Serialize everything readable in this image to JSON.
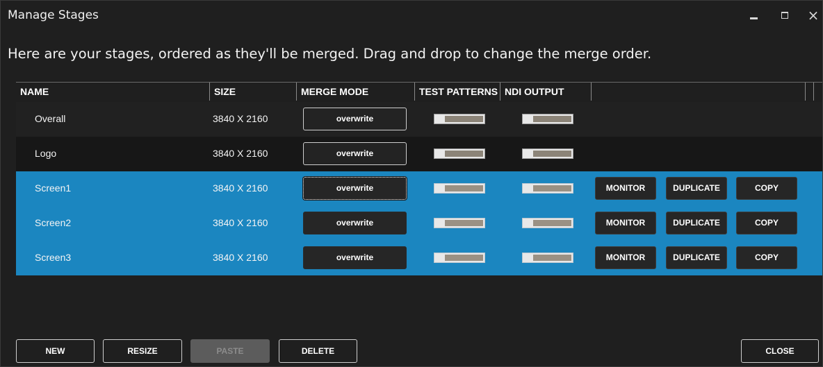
{
  "window": {
    "title": "Manage Stages",
    "controls": {
      "minimize": "minimize-icon",
      "maximize": "maximize-icon",
      "close": "×"
    }
  },
  "instructions": "Here are your stages, ordered as they'll be merged. Drag and drop to change the merge order.",
  "table": {
    "columns": [
      "NAME",
      "SIZE",
      "MERGE MODE",
      "TEST PATTERNS",
      "NDI OUTPUT"
    ],
    "rows": [
      {
        "name": "Overall",
        "size": "3840 X 2160",
        "merge_mode": "overwrite",
        "test_patterns": false,
        "ndi_output": false,
        "selected": false
      },
      {
        "name": "Logo",
        "size": "3840 X 2160",
        "merge_mode": "overwrite",
        "test_patterns": false,
        "ndi_output": false,
        "selected": false
      },
      {
        "name": "Screen1",
        "size": "3840 X 2160",
        "merge_mode": "overwrite",
        "test_patterns": false,
        "ndi_output": false,
        "selected": true,
        "actions": {
          "monitor": "MONITOR",
          "duplicate": "DUPLICATE",
          "copy": "COPY"
        }
      },
      {
        "name": "Screen2",
        "size": "3840 X 2160",
        "merge_mode": "overwrite",
        "test_patterns": false,
        "ndi_output": false,
        "selected": true,
        "actions": {
          "monitor": "MONITOR",
          "duplicate": "DUPLICATE",
          "copy": "COPY"
        }
      },
      {
        "name": "Screen3",
        "size": "3840 X 2160",
        "merge_mode": "overwrite",
        "test_patterns": false,
        "ndi_output": false,
        "selected": true,
        "actions": {
          "monitor": "MONITOR",
          "duplicate": "DUPLICATE",
          "copy": "COPY"
        }
      }
    ]
  },
  "footer": {
    "new": "NEW",
    "resize": "RESIZE",
    "paste": "PASTE",
    "paste_enabled": false,
    "delete": "DELETE",
    "close": "CLOSE"
  },
  "colors": {
    "background": "#1f1f1f",
    "selection": "#1b86c0",
    "button": "#262626",
    "toggle_track": "#8c8478"
  }
}
